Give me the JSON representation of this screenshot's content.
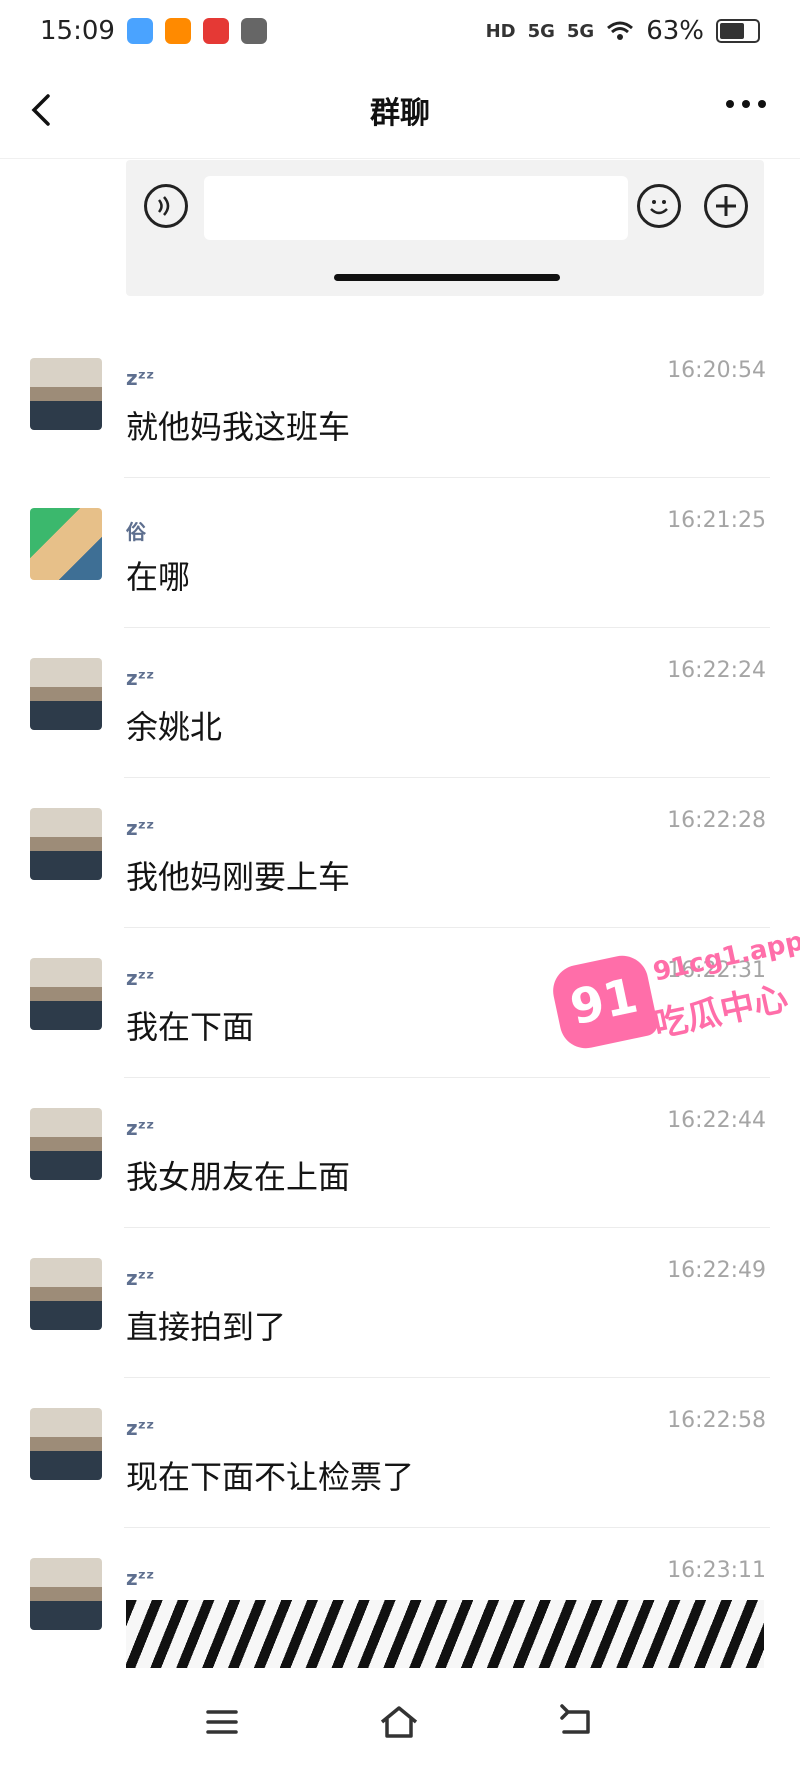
{
  "status_bar": {
    "time": "15:09",
    "hd": "HD",
    "network1": "5G",
    "network2": "5G",
    "battery": "63%"
  },
  "header": {
    "title": "群聊"
  },
  "messages": [
    {
      "sender": "zᶻᶻ",
      "time": "16:20:54",
      "text": "就他妈我这班车",
      "avatar": "photo"
    },
    {
      "sender": "俗",
      "time": "16:21:25",
      "text": "在哪",
      "avatar": "cartoon"
    },
    {
      "sender": "zᶻᶻ",
      "time": "16:22:24",
      "text": "余姚北",
      "avatar": "photo"
    },
    {
      "sender": "zᶻᶻ",
      "time": "16:22:28",
      "text": "我他妈刚要上车",
      "avatar": "photo"
    },
    {
      "sender": "zᶻᶻ",
      "time": "16:22:31",
      "text": "我在下面",
      "avatar": "photo"
    },
    {
      "sender": "zᶻᶻ",
      "time": "16:22:44",
      "text": "我女朋友在上面",
      "avatar": "photo"
    },
    {
      "sender": "zᶻᶻ",
      "time": "16:22:49",
      "text": "直接拍到了",
      "avatar": "photo"
    },
    {
      "sender": "zᶻᶻ",
      "time": "16:22:58",
      "text": "现在下面不让检票了",
      "avatar": "photo"
    },
    {
      "sender": "zᶻᶻ",
      "time": "16:23:11",
      "text": "",
      "avatar": "photo"
    }
  ],
  "watermark": {
    "badge": "91",
    "domain": "91cg1.app",
    "name": "吃瓜中心"
  },
  "icons": {
    "back": "back-chevron-icon",
    "more": "more-dots-icon",
    "voice": "voice-icon",
    "emoji": "emoji-icon",
    "plus": "plus-icon",
    "nav_menu": "menu-icon",
    "nav_home": "home-icon",
    "nav_back": "back-icon"
  }
}
